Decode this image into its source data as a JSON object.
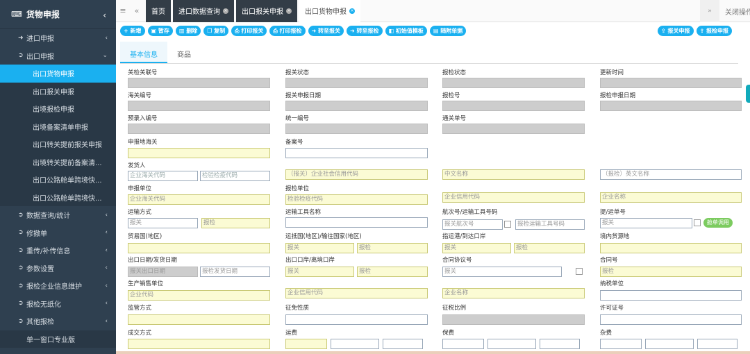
{
  "sidebar": {
    "title": "货物申报",
    "items": [
      {
        "label": "进口申报",
        "type": "top",
        "icon": "login-icon",
        "chev": "‹"
      },
      {
        "label": "出口申报",
        "type": "top",
        "icon": "logout-icon",
        "chev": "›"
      },
      {
        "label": "出口货物申报",
        "type": "sub",
        "active": true
      },
      {
        "label": "出口报关申报",
        "type": "sub"
      },
      {
        "label": "出境报检申报",
        "type": "sub"
      },
      {
        "label": "出境备案清单申报",
        "type": "sub"
      },
      {
        "label": "出口转关提前报关申报",
        "type": "sub"
      },
      {
        "label": "出境转关提前备案清...",
        "type": "sub"
      },
      {
        "label": "出口公路舱单跨境快...",
        "type": "sub"
      },
      {
        "label": "出口公路舱单跨境快...",
        "type": "sub"
      },
      {
        "label": "数据查询/统计",
        "type": "top",
        "chev": "‹"
      },
      {
        "label": "修撤单",
        "type": "top",
        "chev": "‹"
      },
      {
        "label": "重传/补传信息",
        "type": "top",
        "chev": "‹"
      },
      {
        "label": "参数设置",
        "type": "top",
        "chev": "‹"
      },
      {
        "label": "报检企业信息维护",
        "type": "top",
        "chev": "‹"
      },
      {
        "label": "报检无纸化",
        "type": "top",
        "chev": "‹"
      },
      {
        "label": "其他报检",
        "type": "top",
        "chev": "‹"
      },
      {
        "label": "单一窗口专业版",
        "type": "plain"
      }
    ]
  },
  "topbar": {
    "tabs": [
      {
        "label": "首页",
        "style": "dark",
        "close": false
      },
      {
        "label": "进口数据查询",
        "style": "dark",
        "close": true
      },
      {
        "label": "出口报关申报",
        "style": "dark",
        "close": true
      },
      {
        "label": "出口货物申报",
        "style": "light",
        "close": true
      }
    ],
    "close_ops": "关闭操作"
  },
  "toolbar": {
    "left": [
      "新增",
      "暂存",
      "删除",
      "复制",
      "打印报关",
      "打印报检",
      "转至报关",
      "转至报检",
      "初始值模板",
      "随附单据"
    ],
    "right": [
      "报关申报",
      "报检申报"
    ]
  },
  "subtabs": [
    "基本信息",
    "商品"
  ],
  "form": {
    "r1": [
      "关检关联号",
      "报关状态",
      "报检状态",
      "更新时间"
    ],
    "r2": [
      "海关编号",
      "报关申报日期",
      "报检号",
      "报检申报日期"
    ],
    "r3": [
      "预录入编号",
      "统一编号",
      "通关单号"
    ],
    "r4": [
      "申报地海关",
      "备案号"
    ],
    "consignor": "发货人",
    "consignor_ph": [
      "企业海关代码",
      "检验检疫代码",
      "（报关）企业社会信用代码",
      "中文名称",
      "（报检）英文名称"
    ],
    "declarer": "申报单位",
    "inspector": "报检单位",
    "declarer_ph": [
      "企业海关代码",
      "检验检疫代码",
      "企业信用代码",
      "企业名称"
    ],
    "transport_mode": "运输方式",
    "transport_name": "运输工具名称",
    "voyage": "航次号/运输工具号码",
    "bill_no": "提/运单号",
    "ph_customs": "报关",
    "ph_inspect": "报检",
    "voyage_ph1": "报关航次号",
    "voyage_ph2": "报检运输工具号码",
    "manifest_btn": "舱单调用",
    "trade_country": "贸易国(地区)",
    "dest_country": "运抵国(地区)/输往国家(地区)",
    "port": "指运港/到达口岸",
    "source": "境内货源地",
    "export_date": "出口日期/发货日期",
    "export_port": "出口口岸/离境口岸",
    "contract": "合同协议号",
    "contract_no": "合同号",
    "export_date_ph1": "报关出口日期",
    "export_date_ph2": "报检发货日期",
    "producer": "生产销售单位",
    "taxpayer": "纳税单位",
    "producer_ph": [
      "企业代码",
      "企业信用代码",
      "企业名称"
    ],
    "supervision": "监管方式",
    "tax_nature": "征免性质",
    "tax_ratio": "征税比例",
    "license": "许可证号",
    "deal_mode": "成交方式",
    "freight": "运费",
    "insurance": "保费",
    "misc": "杂费"
  }
}
